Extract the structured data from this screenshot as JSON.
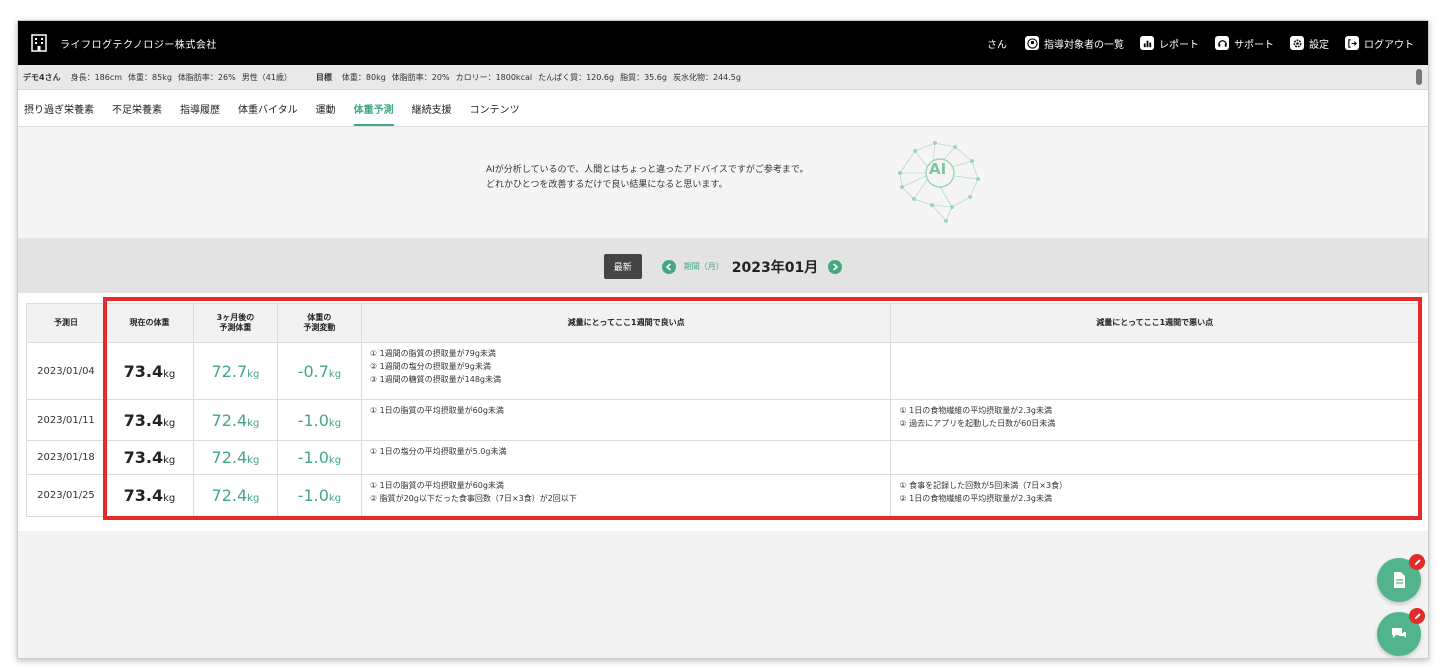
{
  "header": {
    "company": "ライフログテクノロジー株式会社",
    "user_suffix": "さん",
    "nav": [
      {
        "label": "指導対象者の一覧",
        "icon": "user-circle-icon"
      },
      {
        "label": "レポート",
        "icon": "bar-chart-icon"
      },
      {
        "label": "サポート",
        "icon": "headset-icon"
      },
      {
        "label": "設定",
        "icon": "gear-icon"
      },
      {
        "label": "ログアウト",
        "icon": "logout-icon"
      }
    ]
  },
  "profile": {
    "name": "デモ4さん",
    "height": "身長：186cm",
    "weight": "体重：85kg",
    "body_fat": "体脂肪率：26%",
    "sex_age": "男性（41歳）",
    "target_label": "目標",
    "targets": [
      "体重：80kg",
      "体脂肪率：20%",
      "カロリー：1800kcal",
      "たんぱく質：120.6g",
      "脂質：35.6g",
      "炭水化物：244.5g"
    ]
  },
  "tabs": [
    "摂り過ぎ栄養素",
    "不足栄養素",
    "指導履歴",
    "体重バイタル",
    "運動",
    "体重予測",
    "継続支援",
    "コンテンツ"
  ],
  "active_tab": "体重予測",
  "notice": {
    "line1": "AIが分析しているので、人間とはちょっと違ったアドバイスですがご参考まで。",
    "line2": "どれかひとつを改善するだけで良い結果になると思います。",
    "ai_text": "AI"
  },
  "period": {
    "latest": "最新",
    "label": "期間（月）",
    "value": "2023年01月"
  },
  "table": {
    "headers": {
      "date": "予測日",
      "current": "現在の体重",
      "pred_line1": "3ヶ月後の",
      "pred_line2": "予測体重",
      "chg_line1": "体重の",
      "chg_line2": "予測変動",
      "good": "減量にとってここ1週間で良い点",
      "bad": "減量にとってここ1週間で悪い点"
    },
    "unit": "kg",
    "rows": [
      {
        "date": "2023/01/04",
        "current": "73.4",
        "predicted": "72.7",
        "change": "-0.7",
        "good": [
          "① 1週間の脂質の摂取量が79g未満",
          "② 1週間の塩分の摂取量が9g未満",
          "③ 1週間の糖質の摂取量が148g未満"
        ],
        "bad": []
      },
      {
        "date": "2023/01/11",
        "current": "73.4",
        "predicted": "72.4",
        "change": "-1.0",
        "good": [
          "① 1日の脂質の平均摂取量が60g未満"
        ],
        "bad": [
          "① 1日の食物繊維の平均摂取量が2.3g未満",
          "② 過去にアプリを起動した日数が60日未満"
        ]
      },
      {
        "date": "2023/01/18",
        "current": "73.4",
        "predicted": "72.4",
        "change": "-1.0",
        "good": [
          "① 1日の塩分の平均摂取量が5.0g未満"
        ],
        "bad": []
      },
      {
        "date": "2023/01/25",
        "current": "73.4",
        "predicted": "72.4",
        "change": "-1.0",
        "good": [
          "① 1日の脂質の平均摂取量が60g未満",
          "② 脂質が20g以下だった食事回数（7日×3食）が2回以下"
        ],
        "bad": [
          "① 食事を記録した回数が5回未満（7日×3食）",
          "② 1日の食物繊維の平均摂取量が2.3g未満"
        ]
      }
    ]
  },
  "colors": {
    "accent": "#43a880",
    "highlight": "#e32b2b",
    "topbar": "#000000"
  }
}
